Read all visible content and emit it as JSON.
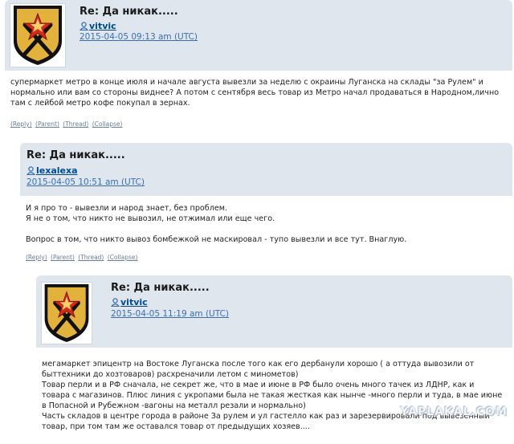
{
  "comments": [
    {
      "title": "Re: Да никак.....",
      "username": "vitvic",
      "date": "2015-04-05 09:13 am (UTC)",
      "text": "супермаркет метро в конце июля и начале августа вывезли за неделю с окраины Луганска на склады \"за Рулем\" и нормально или вам со стороны виднее? А потом с сентября весь товар из Метро начал продаваться в Народном,лично там с лейбой метро кофе покупал в зернах.",
      "actions": [
        "(Reply)",
        "(Parent)",
        "(Thread)",
        "(Collapse)"
      ]
    },
    {
      "title": "Re: Да никак.....",
      "username": "lexalexa",
      "date": "2015-04-05 10:51 am (UTC)",
      "text_lines": [
        "И я про то - вывезли и народ знает, без проблем.",
        "Я не о том, что никто не вывозил, не отжимал или еще чего.",
        "",
        "Вопрос в том, что никто вывоз бомбежкой не маскировал - тупо вывезли и все тут. Внаглую."
      ],
      "actions": [
        "(Reply)",
        "(Parent)",
        "(Thread)",
        "(Collapse)"
      ]
    },
    {
      "title": "Re: Да никак.....",
      "username": "vitvic",
      "date": "2015-04-05 11:19 am (UTC)",
      "text_lines": [
        "мегамаркет эпицентр на Востоке Луганска после того как его дербанули хорошо ( а оттуда вывозили от быттехники до хозтоваров) расхреначили летом с минометов)",
        "Товар перли и в РФ сначала, не секрет же, что в мае и июне в РФ было очень много тачек из ЛДНР, как и товара с магазинов. Плюс линия с укропами была не такая жесткая как нынче -много перли и туда, в мае июне в Попасной и Рубежном -вагоны на металл резали и нормально)",
        "Часть складов в центре города в районе За рулем и ул гастелло как раз и зарезервировали под вывезенный товар, при том там же оставался товар от предыдущих хозяев...."
      ]
    }
  ],
  "watermark": "YAPLAKAL.COM",
  "colors": {
    "panel": "#dfe6ee",
    "link": "#004a94",
    "date": "#3a6fb0"
  },
  "icons": {
    "user": "user-icon",
    "avatar": "soviet-star-emblem"
  }
}
